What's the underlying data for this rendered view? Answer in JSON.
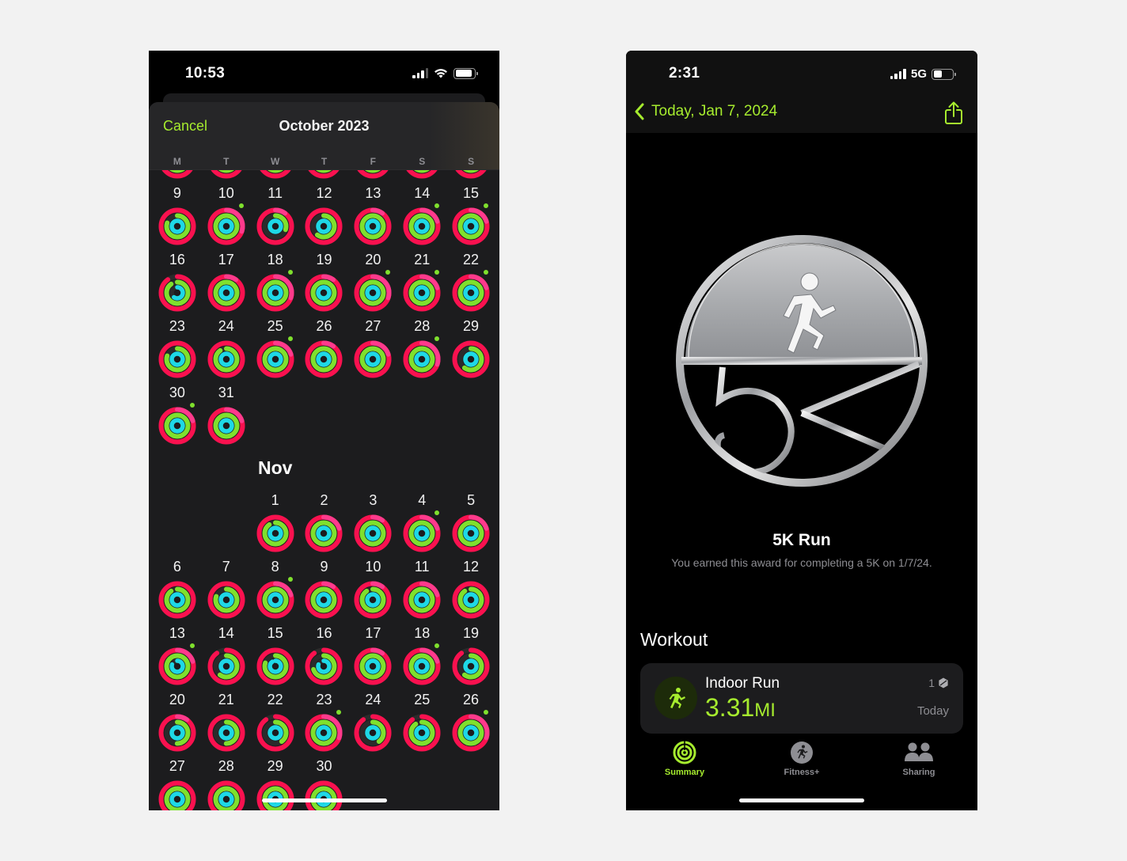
{
  "left_screen": {
    "status_bar": {
      "time": "10:53",
      "signal_bars_active": 3,
      "signal_bars_total": 4,
      "wifi": true,
      "battery_percent": 90
    },
    "sheet": {
      "cancel_label": "Cancel",
      "title": "October 2023",
      "weekdays": [
        "M",
        "T",
        "W",
        "T",
        "F",
        "S",
        "S"
      ]
    },
    "ring_colors": {
      "move": "#fa114f",
      "move_end": "#ff3a8c",
      "exercise": "#7fe02d",
      "exercise_end": "#b6f500",
      "stand": "#1ed8e6",
      "stand_end": "#29b6e6",
      "track": "#2b2b2b"
    },
    "months": [
      {
        "label": "",
        "weeks": [
          [
            {
              "day": "",
              "move": 0.8,
              "exercise": 0.7,
              "stand": 1.0,
              "award": false
            },
            {
              "day": "",
              "move": 1.0,
              "exercise": 1.0,
              "stand": 1.0,
              "award": false
            },
            {
              "day": "",
              "move": 1.2,
              "exercise": 1.0,
              "stand": 1.0,
              "award": true
            },
            {
              "day": "",
              "move": 1.1,
              "exercise": 0.9,
              "stand": 1.0,
              "award": false
            },
            {
              "day": "",
              "move": 1.1,
              "exercise": 0.8,
              "stand": 1.0,
              "award": false
            },
            {
              "day": "",
              "move": 1.0,
              "exercise": 1.0,
              "stand": 1.0,
              "award": false
            },
            {
              "day": "",
              "move": 1.3,
              "exercise": 1.0,
              "stand": 1.0,
              "award": true
            }
          ],
          [
            {
              "day": "9",
              "move": 1.0,
              "exercise": 0.8,
              "stand": 1.0,
              "award": false
            },
            {
              "day": "10",
              "move": 1.3,
              "exercise": 1.0,
              "stand": 1.0,
              "award": true
            },
            {
              "day": "11",
              "move": 1.1,
              "exercise": 0.3,
              "stand": 1.0,
              "award": false
            },
            {
              "day": "12",
              "move": 1.0,
              "exercise": 0.6,
              "stand": 1.0,
              "award": false
            },
            {
              "day": "13",
              "move": 1.1,
              "exercise": 1.0,
              "stand": 1.0,
              "award": false
            },
            {
              "day": "14",
              "move": 1.2,
              "exercise": 1.0,
              "stand": 1.0,
              "award": true
            },
            {
              "day": "15",
              "move": 1.2,
              "exercise": 1.0,
              "stand": 1.0,
              "award": true
            }
          ],
          [
            {
              "day": "16",
              "move": 0.9,
              "exercise": 0.9,
              "stand": 0.6,
              "award": false
            },
            {
              "day": "17",
              "move": 1.1,
              "exercise": 1.0,
              "stand": 1.0,
              "award": false
            },
            {
              "day": "18",
              "move": 1.3,
              "exercise": 1.0,
              "stand": 1.0,
              "award": true
            },
            {
              "day": "19",
              "move": 1.1,
              "exercise": 1.0,
              "stand": 1.0,
              "award": false
            },
            {
              "day": "20",
              "move": 1.3,
              "exercise": 1.0,
              "stand": 1.0,
              "award": true
            },
            {
              "day": "21",
              "move": 1.2,
              "exercise": 1.0,
              "stand": 1.0,
              "award": true
            },
            {
              "day": "22",
              "move": 1.2,
              "exercise": 1.0,
              "stand": 1.0,
              "award": true
            }
          ],
          [
            {
              "day": "23",
              "move": 1.0,
              "exercise": 0.8,
              "stand": 1.0,
              "award": false
            },
            {
              "day": "24",
              "move": 1.0,
              "exercise": 0.9,
              "stand": 1.0,
              "award": false
            },
            {
              "day": "25",
              "move": 1.2,
              "exercise": 1.0,
              "stand": 1.0,
              "award": true
            },
            {
              "day": "26",
              "move": 1.1,
              "exercise": 1.0,
              "stand": 1.0,
              "award": false
            },
            {
              "day": "27",
              "move": 1.2,
              "exercise": 1.0,
              "stand": 1.0,
              "award": false
            },
            {
              "day": "28",
              "move": 1.3,
              "exercise": 1.0,
              "stand": 1.0,
              "award": true
            },
            {
              "day": "29",
              "move": 1.0,
              "exercise": 0.6,
              "stand": 1.0,
              "award": false
            }
          ],
          [
            {
              "day": "30",
              "move": 1.2,
              "exercise": 1.0,
              "stand": 1.0,
              "award": true
            },
            {
              "day": "31",
              "move": 1.2,
              "exercise": 1.0,
              "stand": 1.0,
              "award": false
            }
          ]
        ]
      },
      {
        "label": "Nov",
        "offset": 2,
        "weeks": [
          [
            {
              "day": "1",
              "move": 1.0,
              "exercise": 0.9,
              "stand": 1.0,
              "award": false
            },
            {
              "day": "2",
              "move": 1.2,
              "exercise": 1.0,
              "stand": 1.0,
              "award": false
            },
            {
              "day": "3",
              "move": 1.1,
              "exercise": 1.0,
              "stand": 1.0,
              "award": false
            },
            {
              "day": "4",
              "move": 1.2,
              "exercise": 1.0,
              "stand": 1.0,
              "award": true
            },
            {
              "day": "5",
              "move": 1.2,
              "exercise": 1.0,
              "stand": 1.0,
              "award": false
            }
          ],
          [
            {
              "day": "6",
              "move": 1.0,
              "exercise": 0.9,
              "stand": 1.0,
              "award": false
            },
            {
              "day": "7",
              "move": 1.0,
              "exercise": 0.8,
              "stand": 1.0,
              "award": false
            },
            {
              "day": "8",
              "move": 1.2,
              "exercise": 1.0,
              "stand": 1.0,
              "award": true
            },
            {
              "day": "9",
              "move": 1.1,
              "exercise": 1.0,
              "stand": 1.0,
              "award": false
            },
            {
              "day": "10",
              "move": 1.1,
              "exercise": 0.9,
              "stand": 1.0,
              "award": false
            },
            {
              "day": "11",
              "move": 1.2,
              "exercise": 1.0,
              "stand": 1.0,
              "award": false
            },
            {
              "day": "12",
              "move": 1.0,
              "exercise": 0.9,
              "stand": 1.0,
              "award": false
            }
          ],
          [
            {
              "day": "13",
              "move": 1.2,
              "exercise": 1.0,
              "stand": 0.8,
              "award": true
            },
            {
              "day": "14",
              "move": 0.9,
              "exercise": 0.6,
              "stand": 1.0,
              "award": false
            },
            {
              "day": "15",
              "move": 1.0,
              "exercise": 0.8,
              "stand": 0.9,
              "award": false
            },
            {
              "day": "16",
              "move": 0.9,
              "exercise": 0.7,
              "stand": 0.8,
              "award": false
            },
            {
              "day": "17",
              "move": 1.1,
              "exercise": 1.0,
              "stand": 1.0,
              "award": false
            },
            {
              "day": "18",
              "move": 1.2,
              "exercise": 1.0,
              "stand": 1.0,
              "award": true
            },
            {
              "day": "19",
              "move": 0.9,
              "exercise": 0.6,
              "stand": 1.0,
              "award": false
            }
          ],
          [
            {
              "day": "20",
              "move": 1.1,
              "exercise": 0.5,
              "stand": 1.0,
              "award": false
            },
            {
              "day": "21",
              "move": 1.0,
              "exercise": 0.5,
              "stand": 1.0,
              "award": false
            },
            {
              "day": "22",
              "move": 0.9,
              "exercise": 0.4,
              "stand": 1.0,
              "award": false
            },
            {
              "day": "23",
              "move": 1.3,
              "exercise": 1.0,
              "stand": 1.0,
              "award": true
            },
            {
              "day": "24",
              "move": 0.9,
              "exercise": 0.4,
              "stand": 1.0,
              "award": false
            },
            {
              "day": "25",
              "move": 0.9,
              "exercise": 0.9,
              "stand": 1.0,
              "award": false
            },
            {
              "day": "26",
              "move": 1.3,
              "exercise": 1.0,
              "stand": 1.0,
              "award": true
            }
          ],
          [
            {
              "day": "27",
              "move": 1.0,
              "exercise": 1.0,
              "stand": 1.0,
              "award": false
            },
            {
              "day": "28",
              "move": 1.0,
              "exercise": 1.0,
              "stand": 1.0,
              "award": false
            },
            {
              "day": "29",
              "move": 1.0,
              "exercise": 1.0,
              "stand": 1.0,
              "award": false
            },
            {
              "day": "30",
              "move": 1.0,
              "exercise": 1.0,
              "stand": 1.0,
              "award": false
            }
          ]
        ]
      }
    ]
  },
  "right_screen": {
    "status_bar": {
      "time": "2:31",
      "signal_bars_active": 4,
      "signal_bars_total": 4,
      "network": "5G",
      "battery_percent": 45
    },
    "nav": {
      "back_label": "Today, Jan 7, 2024",
      "share_icon": "share-icon"
    },
    "award": {
      "badge_icon": "5k-run-medal",
      "badge_text": "5K",
      "title": "5K Run",
      "description": "You earned this award for completing a 5K on 1/7/24."
    },
    "workout_section": {
      "title": "Workout",
      "card": {
        "name": "Indoor Run",
        "distance_value": "3.31",
        "distance_unit": "MI",
        "count": "1",
        "count_icon": "award-badge-icon",
        "date": "Today"
      }
    },
    "tabs": [
      {
        "label": "Summary",
        "icon": "activity-rings-icon",
        "active": true
      },
      {
        "label": "Fitness+",
        "icon": "fitness-plus-icon",
        "active": false
      },
      {
        "label": "Sharing",
        "icon": "sharing-people-icon",
        "active": false
      }
    ],
    "accent_color": "#a6ec2e"
  }
}
